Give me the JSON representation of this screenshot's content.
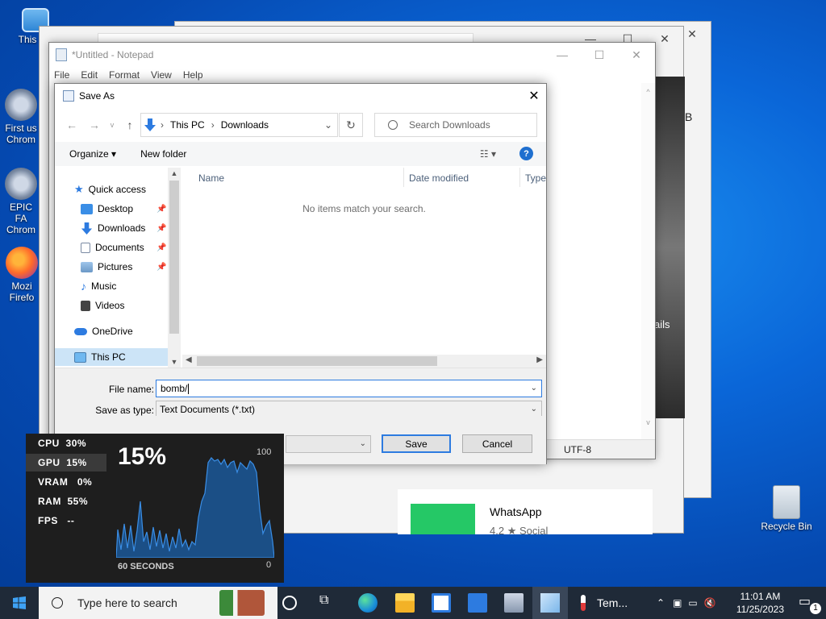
{
  "desktop": {
    "icons": [
      {
        "label": "This PC"
      },
      {
        "label": "First us Chrom"
      },
      {
        "label": "EPIC FA Chrom"
      },
      {
        "label": "Mozi Firefo"
      },
      {
        "label": "Recycle Bin"
      }
    ]
  },
  "notepad": {
    "title": "*Untitled - Notepad",
    "menu": [
      "File",
      "Edit",
      "Format",
      "View",
      "Help"
    ],
    "encoding": "UTF-8"
  },
  "store": {
    "app_name": "WhatsApp",
    "rating": "4.2",
    "category": "Social",
    "partial_text_1": "B",
    "partial_text_2": "ails"
  },
  "dialog": {
    "title": "Save As",
    "address": {
      "root": "This PC",
      "folder": "Downloads"
    },
    "search_placeholder": "Search Downloads",
    "organize_label": "Organize",
    "new_folder_label": "New folder",
    "nav_items": [
      {
        "label": "Quick access"
      },
      {
        "label": "Desktop"
      },
      {
        "label": "Downloads"
      },
      {
        "label": "Documents"
      },
      {
        "label": "Pictures"
      },
      {
        "label": "Music"
      },
      {
        "label": "Videos"
      },
      {
        "label": "OneDrive"
      },
      {
        "label": "This PC"
      }
    ],
    "columns": [
      "Name",
      "Date modified",
      "Type"
    ],
    "empty_message": "No items match your search.",
    "file_name_label": "File name:",
    "file_name_value": "bomb/",
    "save_type_label": "Save as type:",
    "save_type_value": "Text Documents (*.txt)",
    "save_button": "Save",
    "cancel_button": "Cancel"
  },
  "perf": {
    "stats": [
      {
        "label": "CPU",
        "value": "30%"
      },
      {
        "label": "GPU",
        "value": "15%"
      },
      {
        "label": "VRAM",
        "value": "0%"
      },
      {
        "label": "RAM",
        "value": "55%"
      },
      {
        "label": "FPS",
        "value": "--"
      }
    ],
    "big_value": "15%",
    "max_label": "100",
    "min_label": "0",
    "duration_label": "60 SECONDS"
  },
  "taskbar": {
    "search_placeholder": "Type here to search",
    "temp_label": "Tem...",
    "time": "11:01 AM",
    "date": "11/25/2023",
    "notification_count": "1"
  },
  "colors": {
    "accent": "#2d7be0",
    "taskbar": "#1f2a38",
    "desktop": "#0a66d8"
  }
}
